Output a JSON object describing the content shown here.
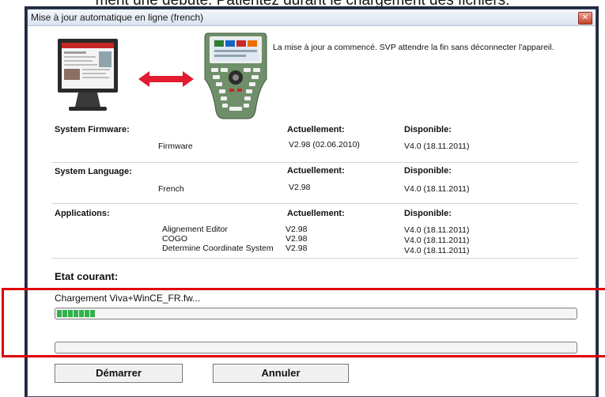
{
  "caption": "ment une débuté. Patientez durant le chargement des fichiers.",
  "window": {
    "title": "Mise à jour automatique en ligne (french)",
    "close_icon": "close-icon"
  },
  "status_message": "La mise à jour a commencé. SVP attendre la fin sans déconnecter l'appareil.",
  "sections": {
    "firmware": {
      "label": "System Firmware:",
      "current_header": "Actuellement:",
      "available_header": "Disponible:",
      "rows": [
        {
          "name": "Firmware",
          "current": "V2.98 (02.06.2010)",
          "available": "V4.0 (18.11.2011)"
        }
      ]
    },
    "language": {
      "label": "System Language:",
      "current_header": "Actuellement:",
      "available_header": "Disponible:",
      "rows": [
        {
          "name": "French",
          "current": "V2.98",
          "available": "V4.0 (18.11.2011)"
        }
      ]
    },
    "applications": {
      "label": "Applications:",
      "current_header": "Actuellement:",
      "available_header": "Disponible:",
      "rows": [
        {
          "name": "Alignement Editor",
          "current": "V2.98",
          "available": "V4.0 (18.11.2011)"
        },
        {
          "name": "COGO",
          "current": "V2.98",
          "available": "V4.0 (18.11.2011)"
        },
        {
          "name": "Determine Coordinate System",
          "current": "V2.98",
          "available": "V4.0 (18.11.2011)"
        }
      ]
    }
  },
  "etat_label": "Etat courant:",
  "loading_text": "Chargement  Viva+WinCE_FR.fw...",
  "progress": {
    "file_fraction": 0.08,
    "overall_fraction": 0.0,
    "color": "#2fb24a"
  },
  "buttons": {
    "start": "Démarrer",
    "cancel": "Annuler"
  },
  "highlight_color": "#e00000"
}
